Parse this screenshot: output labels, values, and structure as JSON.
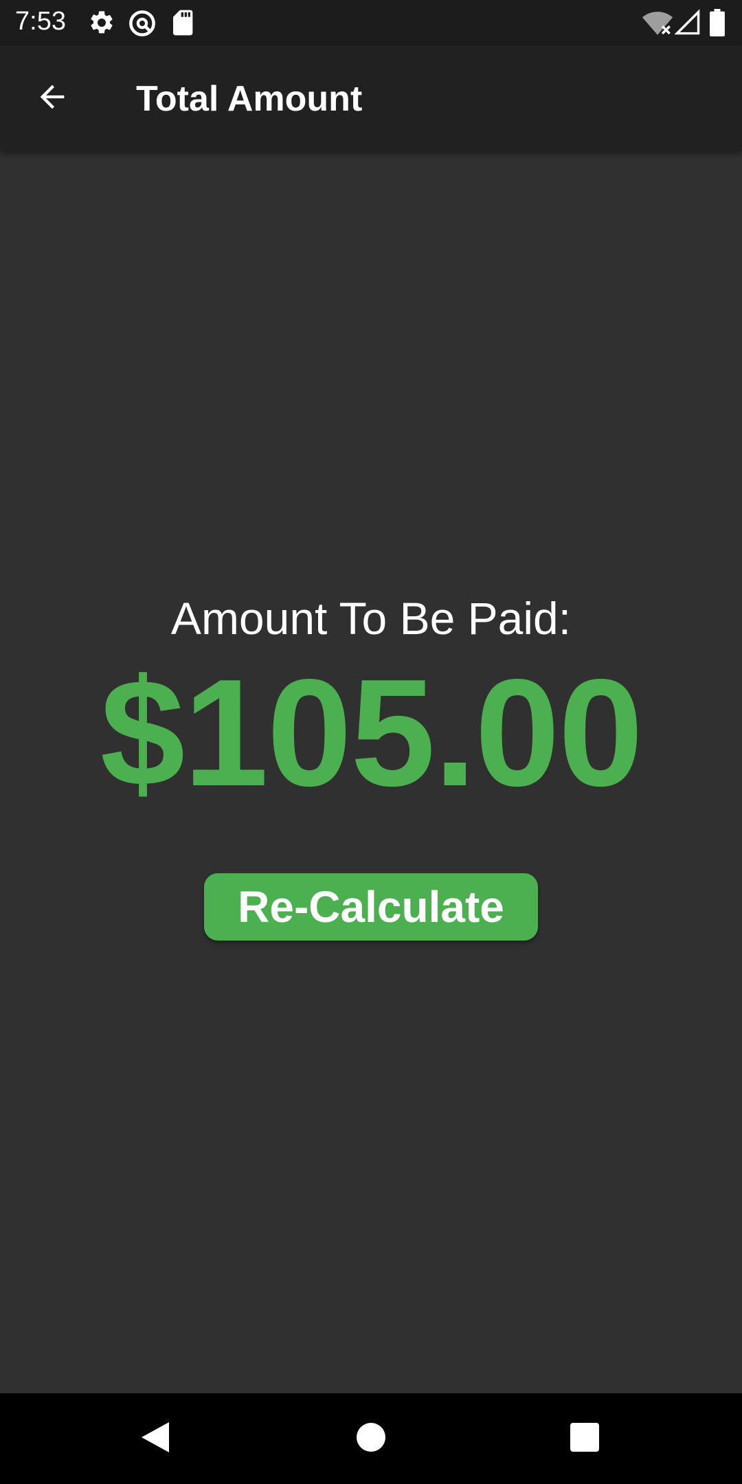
{
  "status_bar": {
    "time": "7:53",
    "icons": [
      "gear-icon",
      "at-sign-icon",
      "sd-card-icon",
      "wifi-off-icon",
      "signal-icon",
      "battery-icon"
    ]
  },
  "app_bar": {
    "title": "Total Amount",
    "back_icon": "arrow-left-icon"
  },
  "main": {
    "label": "Amount To Be Paid:",
    "amount": "$105.00",
    "recalculate_label": "Re-Calculate"
  },
  "nav_bar": {
    "icons": [
      "back-triangle-icon",
      "home-circle-icon",
      "recents-square-icon"
    ]
  },
  "colors": {
    "accent": "#4caf50",
    "background": "#303030",
    "app_bar": "#212121",
    "status_bar": "#1c1c1c"
  }
}
